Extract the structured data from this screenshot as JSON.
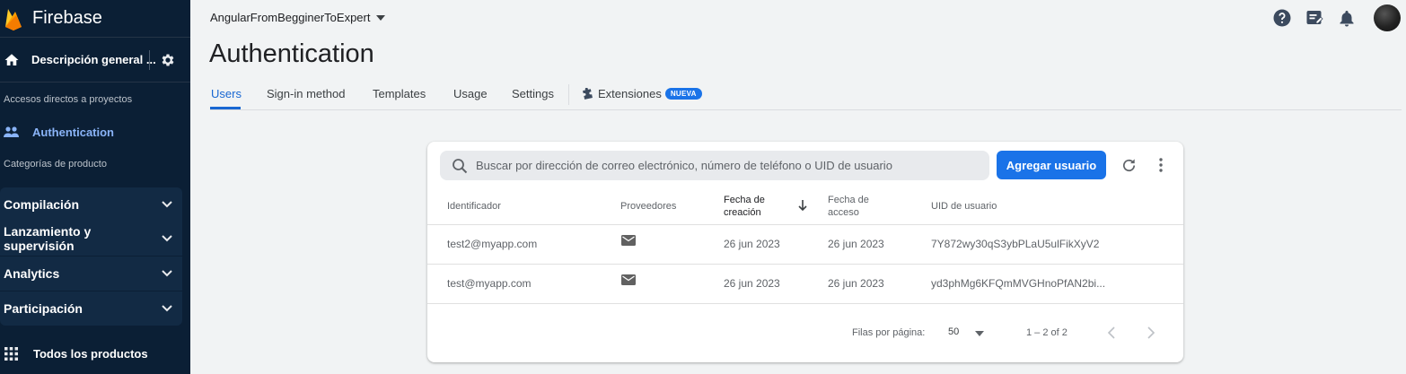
{
  "brand": {
    "name": "Firebase"
  },
  "sidebar": {
    "overview_label": "Descripción general ...",
    "shortcuts_label": "Accesos directos a proyectos",
    "active_item": "Authentication",
    "categories_label": "Categorías de producto",
    "groups": [
      {
        "label": "Compilación"
      },
      {
        "label": "Lanzamiento y supervisión"
      },
      {
        "label": "Analytics"
      },
      {
        "label": "Participación"
      }
    ],
    "all_products_label": "Todos los productos"
  },
  "header": {
    "project_name": "AngularFromBegginerToExpert",
    "page_title": "Authentication"
  },
  "tabs": [
    {
      "label": "Users",
      "active": true
    },
    {
      "label": "Sign-in method"
    },
    {
      "label": "Templates"
    },
    {
      "label": "Usage"
    },
    {
      "label": "Settings"
    }
  ],
  "extensions": {
    "label": "Extensiones",
    "badge": "NUEVA"
  },
  "users_table": {
    "search_placeholder": "Buscar por dirección de correo electrónico, número de teléfono o UID de usuario",
    "add_button": "Agregar usuario",
    "columns": {
      "identifier": "Identificador",
      "providers": "Proveedores",
      "created_line1": "Fecha de",
      "created_line2": "creación",
      "signed_in_line1": "Fecha de",
      "signed_in_line2": "acceso",
      "uid": "UID de usuario"
    },
    "rows": [
      {
        "identifier": "test2@myapp.com",
        "provider": "mail-icon",
        "created": "26 jun 2023",
        "signed_in": "26 jun 2023",
        "uid": "7Y872wy30qS3ybPLaU5ulFikXyV2"
      },
      {
        "identifier": "test@myapp.com",
        "provider": "mail-icon",
        "created": "26 jun 2023",
        "signed_in": "26 jun 2023",
        "uid": "yd3phMg6KFQmMVGHnoPfAN2bi..."
      }
    ],
    "rows_per_page_label": "Filas por página:",
    "rows_per_page": "50",
    "range_label": "1 – 2 of 2"
  },
  "colors": {
    "sidebar_bg": "#0b1f35",
    "accent": "#1a73e8",
    "active_nav": "#8ab4f8"
  }
}
